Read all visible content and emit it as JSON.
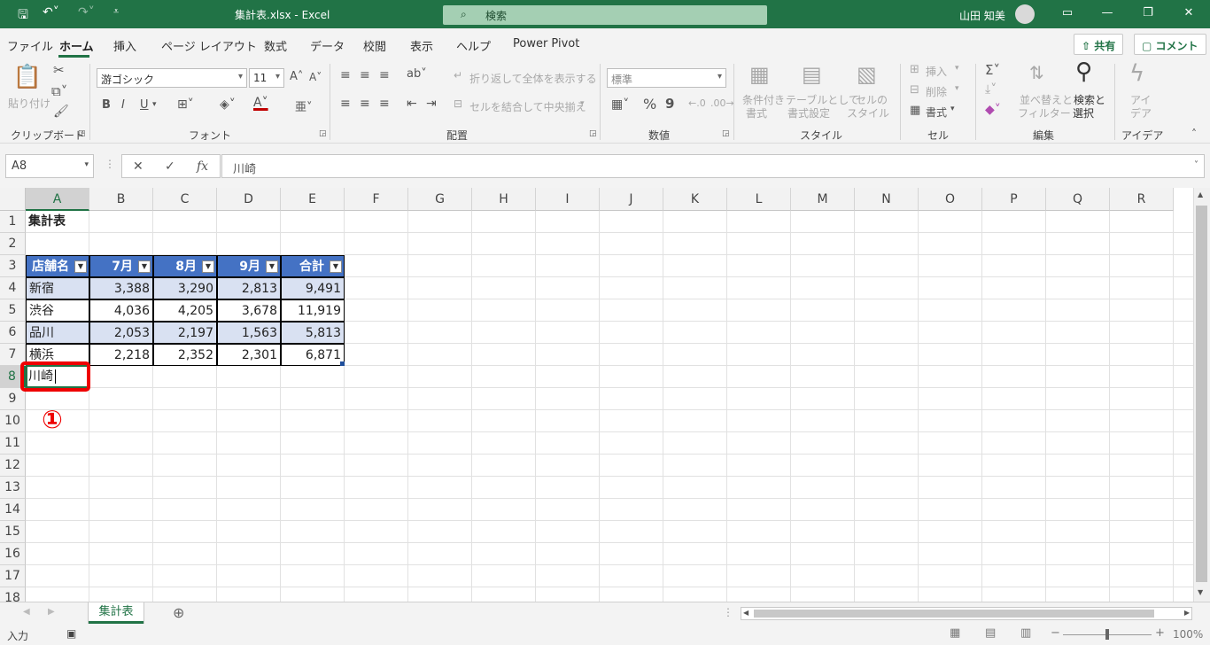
{
  "titlebar": {
    "save_icon": "save-icon",
    "undo_icon": "undo-icon",
    "redo_icon": "redo-icon",
    "title": "集計表.xlsx  -  Excel",
    "search_placeholder": "検索",
    "user_name": "山田 知美"
  },
  "menu": {
    "tabs": [
      "ファイル",
      "ホーム",
      "挿入",
      "ページ レイアウト",
      "数式",
      "データ",
      "校閲",
      "表示",
      "ヘルプ",
      "Power Pivot"
    ],
    "active": "ホーム",
    "share": "共有",
    "comments": "コメント"
  },
  "ribbon": {
    "clipboard": {
      "paste": "貼り付け",
      "label": "クリップボード"
    },
    "font": {
      "name": "游ゴシック",
      "size": "11",
      "label": "フォント",
      "bold": "B",
      "italic": "I",
      "underline": "U"
    },
    "alignment": {
      "wrap": "折り返して全体を表示する",
      "merge": "セルを結合して中央揃え",
      "label": "配置"
    },
    "number": {
      "format": "標準",
      "percent": "%",
      "comma": "9",
      "label": "数値"
    },
    "styles": {
      "conditional_1": "条件付き",
      "conditional_2": "書式",
      "table_1": "テーブルとして",
      "table_2": "書式設定",
      "cell_1": "セルの",
      "cell_2": "スタイル",
      "label": "スタイル"
    },
    "cells": {
      "insert": "挿入",
      "delete": "削除",
      "format": "書式",
      "label": "セル"
    },
    "editing": {
      "sort_1": "並べ替えと",
      "sort_2": "フィルター",
      "find_1": "検索と",
      "find_2": "選択",
      "label": "編集"
    },
    "ideas": {
      "name_1": "アイ",
      "name_2": "デア",
      "label": "アイデア"
    }
  },
  "formula": {
    "name_box": "A8",
    "cancel": "✕",
    "enter": "✓",
    "fx": "fx",
    "content": "川崎"
  },
  "columns": [
    "A",
    "B",
    "C",
    "D",
    "E",
    "F",
    "G",
    "H",
    "I",
    "J",
    "K",
    "L",
    "M",
    "N",
    "O",
    "P",
    "Q",
    "R"
  ],
  "rows": [
    "1",
    "2",
    "3",
    "4",
    "5",
    "6",
    "7",
    "8",
    "9",
    "10",
    "11",
    "12",
    "13",
    "14",
    "15",
    "16",
    "17",
    "18"
  ],
  "sheet": {
    "title": "集計表",
    "table": {
      "headers": [
        "店舗名",
        "7月",
        "8月",
        "9月",
        "合計"
      ],
      "rows": [
        [
          "新宿",
          "3,388",
          "3,290",
          "2,813",
          "9,491"
        ],
        [
          "渋谷",
          "4,036",
          "4,205",
          "3,678",
          "11,919"
        ],
        [
          "品川",
          "2,053",
          "2,197",
          "1,563",
          "5,813"
        ],
        [
          "横浜",
          "2,218",
          "2,352",
          "2,301",
          "6,871"
        ]
      ]
    },
    "a8": "川崎"
  },
  "annotation": {
    "marker": "①",
    "color": "#ee0000"
  },
  "sheet_tabs": [
    "集計表"
  ],
  "status": {
    "mode": "入力",
    "zoom": "100%"
  },
  "colors": {
    "accent": "#217346",
    "table_header": "#4472c4",
    "table_band": "#d9e1f2"
  }
}
